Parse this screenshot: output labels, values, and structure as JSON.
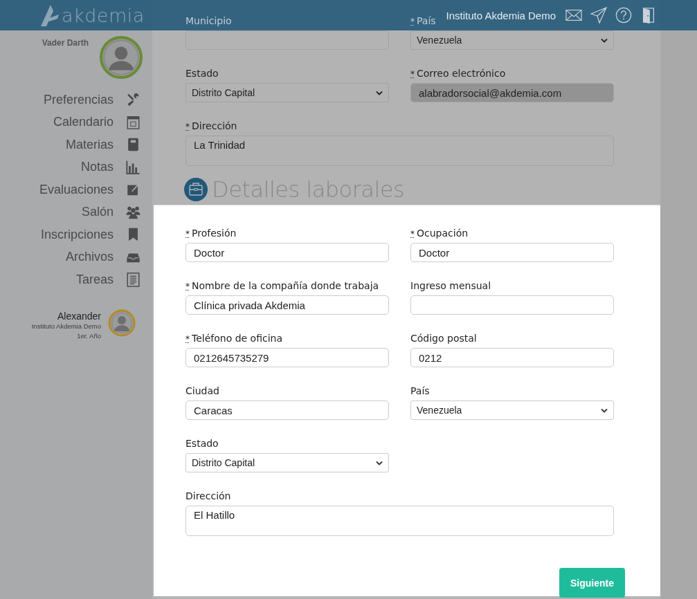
{
  "header": {
    "logo": "akdemia",
    "institution": "Instituto Akdemia Demo"
  },
  "user": {
    "name": "Vader Darth"
  },
  "nav": [
    {
      "label": "Preferencias",
      "kind": "tools"
    },
    {
      "label": "Calendario",
      "kind": "calendar"
    },
    {
      "label": "Materias",
      "kind": "notebook"
    },
    {
      "label": "Notas",
      "kind": "chart"
    },
    {
      "label": "Evaluaciones",
      "kind": "edit"
    },
    {
      "label": "Salón",
      "kind": "group"
    },
    {
      "label": "Inscripciones",
      "kind": "bookmark"
    },
    {
      "label": "Archivos",
      "kind": "inbox"
    },
    {
      "label": "Tareas",
      "kind": "clipboard"
    }
  ],
  "student": {
    "name": "Alexander",
    "school": "Instituto Akdemia Demo",
    "grade": "1er. Año"
  },
  "personal_fields": [
    {
      "label": "Municipio",
      "kind": "input",
      "disabled": false
    },
    {
      "label": "País",
      "mark": "*",
      "kind": "select",
      "value": "Venezuela",
      "disabled": false
    },
    {
      "label": "Estado",
      "kind": "select",
      "value": "Distrito Capital",
      "disabled": false
    },
    {
      "label": "Correo electrónico",
      "mark": "*",
      "kind": "input",
      "value": "alabradorsocial@akdemia.com",
      "disabled": true
    },
    {
      "label": "Dirección",
      "mark": "*",
      "kind": "textarea",
      "value": "La Trinidad",
      "disabled": false
    }
  ],
  "section": {
    "title": "Detalles laborales"
  },
  "work_fields": [
    {
      "label": "Profesión",
      "mark": "*",
      "kind": "input",
      "value": "Doctor"
    },
    {
      "label": "Ocupación",
      "mark": "*",
      "kind": "input",
      "value": "Doctor"
    },
    {
      "label": "Nombre de la compañía donde trabaja",
      "mark": "*",
      "kind": "input",
      "value": "Clínica privada Akdemia"
    },
    {
      "label": "Ingreso mensual",
      "kind": "input"
    },
    {
      "label": "Teléfono de oficina",
      "mark": "*",
      "kind": "input",
      "value": "0212645735279"
    },
    {
      "label": "Código postal",
      "kind": "input",
      "value": "0212"
    },
    {
      "label": "Ciudad",
      "kind": "input",
      "value": "Caracas"
    },
    {
      "label": "País",
      "kind": "select",
      "value": "Venezuela"
    },
    {
      "label": "Estado",
      "kind": "select",
      "value": "Distrito Capital"
    },
    {
      "label": "Dirección",
      "kind": "textarea",
      "value": "El Hatillo"
    }
  ],
  "next_button": "Siguiente"
}
